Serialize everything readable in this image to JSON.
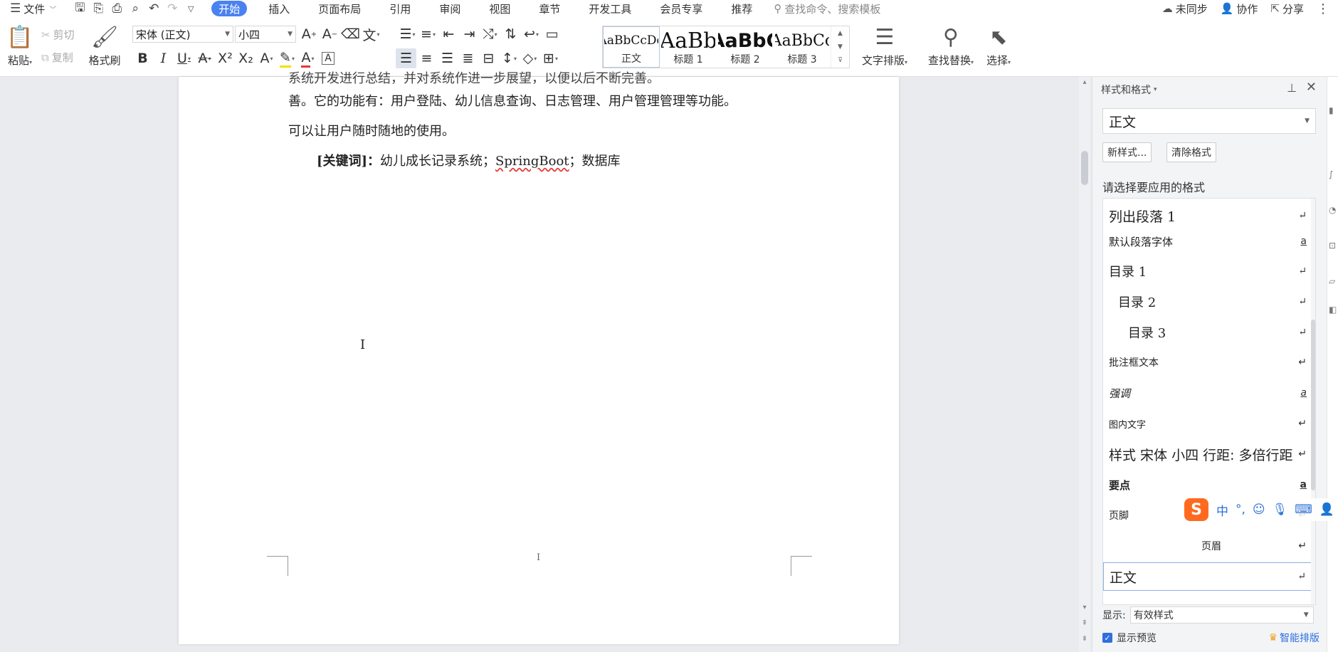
{
  "menu": {
    "file_label": "文件",
    "quick_access": [
      "save-icon",
      "save-as-icon",
      "print-icon",
      "print-preview-icon",
      "undo-icon",
      "redo-icon",
      "customize-icon"
    ],
    "tabs": [
      "开始",
      "插入",
      "页面布局",
      "引用",
      "审阅",
      "视图",
      "章节",
      "开发工具",
      "会员专享",
      "推荐"
    ],
    "active_tab": "开始",
    "search_placeholder": "查找命令、搜索模板",
    "sync_label": "未同步",
    "collab_label": "协作",
    "share_label": "分享"
  },
  "ribbon": {
    "paste_label": "粘贴",
    "cut_label": "剪切",
    "copy_label": "复制",
    "format_painter_label": "格式刷",
    "font_name": "宋体 (正文)",
    "font_size": "小四",
    "styles": [
      {
        "preview": "AaBbCcDd",
        "name": "正文"
      },
      {
        "preview": "AaBb",
        "name": "标题 1"
      },
      {
        "preview": "AaBbC",
        "name": "标题 2"
      },
      {
        "preview": "AaBbCc",
        "name": "标题 3"
      }
    ],
    "text_layout_label": "文字排版",
    "find_replace_label": "查找替换",
    "select_label": "选择"
  },
  "document": {
    "line0": "系统开发进行总结，并对系统作进一步展望，以便以后不断完善。",
    "line1": "善。它的功能有：用户登陆、幼儿信息查询、日志管理、用户管理管理等功能。",
    "line2": "可以让用户随时随地的使用。",
    "keywords_label": "[关键词]：",
    "keywords_text_a": "幼儿成长记录系统；",
    "keywords_spell": "SpringBoot",
    "keywords_text_b": "；数据库",
    "cursor_glyph": "I"
  },
  "pane": {
    "title": "样式和格式",
    "current_style": "正文",
    "new_style_label": "新样式...",
    "clear_format_label": "清除格式",
    "apply_label": "请选择要应用的格式",
    "items": [
      {
        "label": "列出段落 1",
        "mark": "↵"
      },
      {
        "label": "默认段落字体",
        "mark": "a"
      },
      {
        "label": "目录 1",
        "mark": "↵"
      },
      {
        "label": "目录 2",
        "mark": "↵"
      },
      {
        "label": "目录 3",
        "mark": "↵"
      },
      {
        "label": "批注框文本",
        "mark": "↵"
      },
      {
        "label": "强调",
        "mark": "a"
      },
      {
        "label": "图内文字",
        "mark": "↵"
      },
      {
        "label": "样式 宋体 小四 行距: 多倍行距",
        "mark": "↵"
      },
      {
        "label": "要点",
        "mark": "a"
      },
      {
        "label": "页脚",
        "mark": "↵"
      },
      {
        "label": "页眉",
        "mark": "↵"
      },
      {
        "label": "正文",
        "mark": "↵"
      }
    ],
    "show_label": "显示:",
    "show_value": "有效样式",
    "preview_label": "显示预览",
    "smart_label": "智能排版"
  },
  "ime": {
    "logo": "S",
    "mode": "中"
  },
  "colors": {
    "accent": "#4a82f0",
    "ime_orange": "#ff6a1f",
    "spell_error": "#e53935"
  }
}
